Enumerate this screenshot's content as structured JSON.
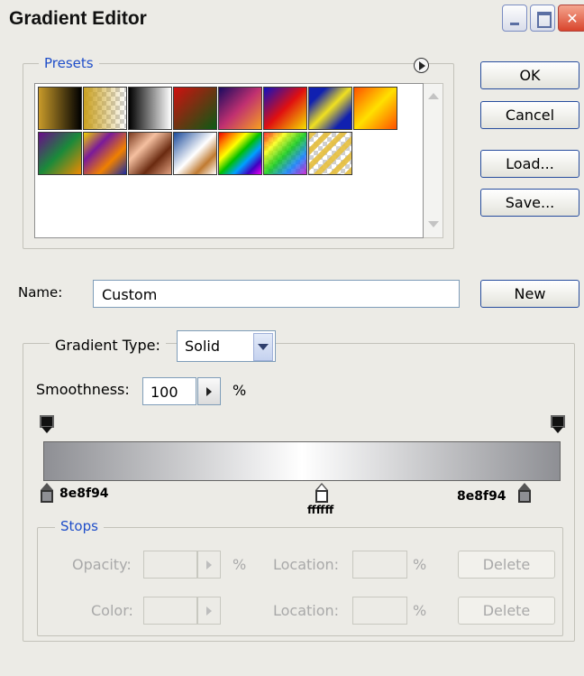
{
  "window": {
    "title": "Gradient Editor",
    "minimize_glyph": "_",
    "close_glyph": "✕"
  },
  "presets": {
    "legend": "Presets",
    "menu_icon": "circle-arrow-right-icon",
    "swatches": [
      {
        "name": "foreground-to-background",
        "gradient": "linear-gradient(90deg,#C89A2A,#000000)"
      },
      {
        "name": "foreground-to-transparent",
        "gradient": "linear-gradient(90deg,#C9A020,rgba(201,160,32,0))",
        "checker": true
      },
      {
        "name": "black-white",
        "gradient": "linear-gradient(90deg,#000000,#FFFFFF)"
      },
      {
        "name": "red-green",
        "gradient": "linear-gradient(135deg,#D01010,#0B5A14)"
      },
      {
        "name": "violet-orange",
        "gradient": "linear-gradient(135deg,#1A0A60,#C03070,#F7A020)"
      },
      {
        "name": "blue-red-yellow",
        "gradient": "linear-gradient(135deg,#1010C0,#E01010,#F5E000)"
      },
      {
        "name": "blue-yellow-blue",
        "gradient": "linear-gradient(135deg,#1020B0 20%,#F0E020 50%,#1020B0 80%)"
      },
      {
        "name": "orange-yellow-orange",
        "gradient": "linear-gradient(135deg,#FF5000,#FFE000,#FF5000)"
      },
      {
        "name": "violet-green-orange",
        "gradient": "linear-gradient(135deg,#6A0A8A,#1A8A3A,#F08A00)"
      },
      {
        "name": "yellow-violet-orange-blue",
        "gradient": "linear-gradient(135deg,#F0D000,#7A1A9A,#F08000,#1A2AA0)"
      },
      {
        "name": "copper",
        "gradient": "linear-gradient(135deg,#7A3A20,#F5C0A0,#6A2A10,#E0A080)"
      },
      {
        "name": "chrome",
        "gradient": "linear-gradient(135deg,#1A4A9A,#FFFFFF 50%,#C07A30,#FFFFFF)"
      },
      {
        "name": "spectrum",
        "gradient": "linear-gradient(135deg,#F00000,#FF8000,#FFFF00,#00C000,#00A0FF,#4000C0,#F000F0)"
      },
      {
        "name": "transparent-rainbow",
        "gradient": "linear-gradient(135deg,rgba(255,0,0,.8),rgba(255,255,0,.8),rgba(0,200,0,.8),rgba(0,120,255,.8),rgba(200,0,200,.8))",
        "checker": true
      },
      {
        "name": "transparent-stripes",
        "gradient": "repeating-linear-gradient(135deg,rgba(230,190,60,.9) 0 6px,rgba(255,255,255,0) 6px 12px)",
        "checker": true
      }
    ]
  },
  "buttons": {
    "ok": "OK",
    "cancel": "Cancel",
    "load": "Load...",
    "save": "Save...",
    "new": "New"
  },
  "name": {
    "label": "Name:",
    "value": "Custom"
  },
  "gradient_type": {
    "label": "Gradient Type:",
    "value": "Solid"
  },
  "smoothness": {
    "label": "Smoothness:",
    "value": "100",
    "unit": "%"
  },
  "gradient": {
    "css": "linear-gradient(90deg,#8E8F94 0%,#FFFFFF 50%,#8E8F94 100%)",
    "color_stops": [
      {
        "location": 0,
        "label": "8e8f94",
        "color": "#8E8F94"
      },
      {
        "location": 50,
        "label": "ffffff",
        "color": "#FFFFFF"
      },
      {
        "location": 100,
        "label": "8e8f94",
        "color": "#8E8F94"
      }
    ],
    "opacity_stops": [
      {
        "location": 0
      },
      {
        "location": 100
      }
    ]
  },
  "stops": {
    "legend": "Stops",
    "opacity_label": "Opacity:",
    "opacity_unit": "%",
    "location_label": "Location:",
    "location_unit": "%",
    "color_label": "Color:",
    "delete_label": "Delete"
  }
}
